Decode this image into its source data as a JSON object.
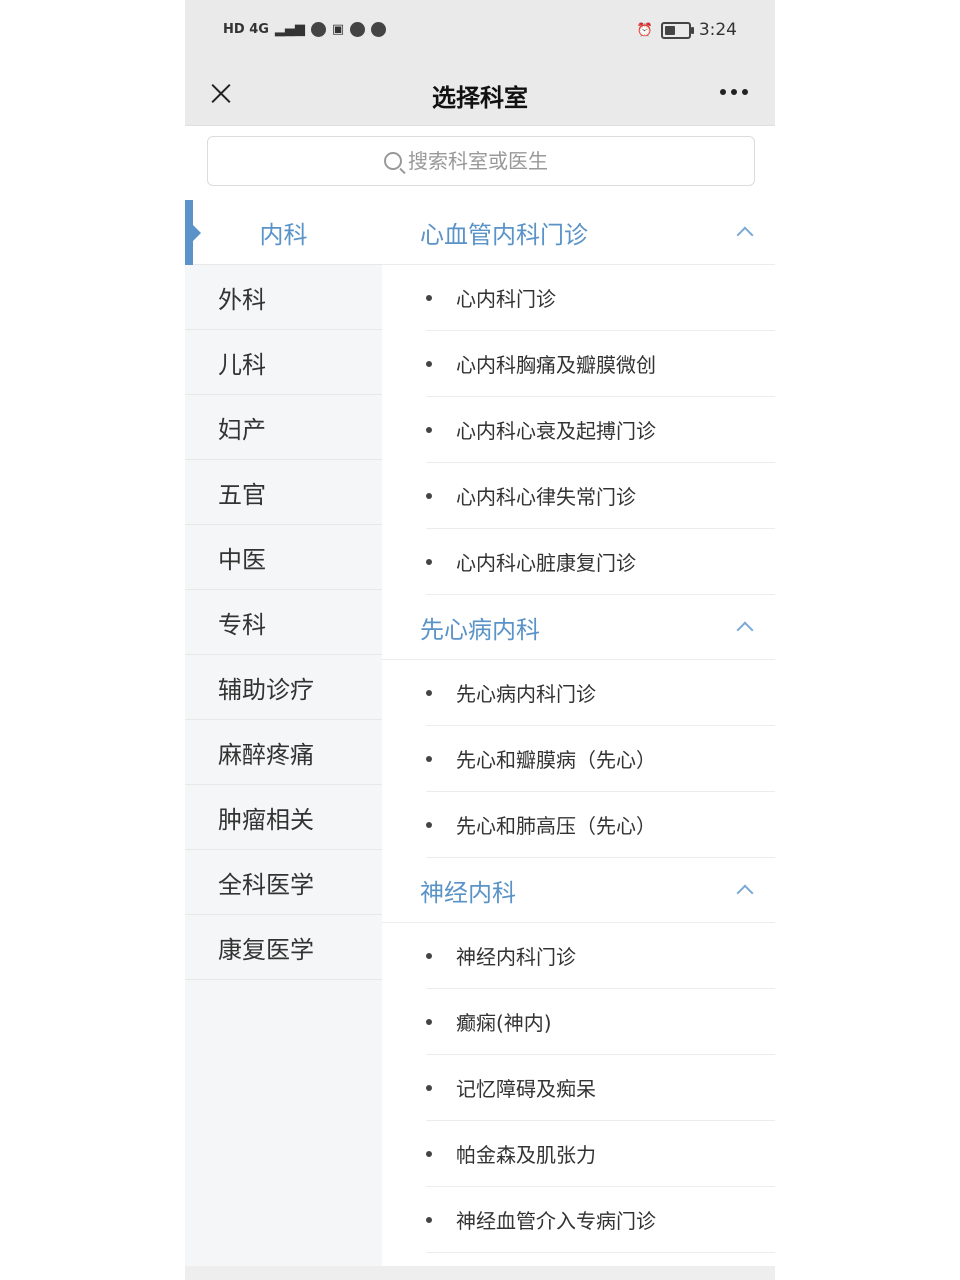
{
  "status_bar": {
    "network": "HD 4G",
    "time": "3:24"
  },
  "header": {
    "title": "选择科室"
  },
  "search": {
    "placeholder": "搜索科室或医生"
  },
  "nav": {
    "items": [
      {
        "label": "内科",
        "active": true
      },
      {
        "label": "外科"
      },
      {
        "label": "儿科"
      },
      {
        "label": "妇产"
      },
      {
        "label": "五官"
      },
      {
        "label": "中医"
      },
      {
        "label": "专科"
      },
      {
        "label": "辅助诊疗"
      },
      {
        "label": "麻醉疼痛"
      },
      {
        "label": "肿瘤相关"
      },
      {
        "label": "全科医学"
      },
      {
        "label": "康复医学"
      }
    ]
  },
  "groups": [
    {
      "title": "心血管内科门诊",
      "items": [
        "心内科门诊",
        "心内科胸痛及瓣膜微创",
        "心内科心衰及起搏门诊",
        "心内科心律失常门诊",
        "心内科心脏康复门诊"
      ]
    },
    {
      "title": "先心病内科",
      "items": [
        "先心病内科门诊",
        "先心和瓣膜病（先心）",
        "先心和肺高压（先心）"
      ]
    },
    {
      "title": "神经内科",
      "items": [
        "神经内科门诊",
        "癫痫(神内)",
        "记忆障碍及痴呆",
        "帕金森及肌张力",
        "神经血管介入专病门诊"
      ]
    }
  ],
  "colors": {
    "accent": "#5a93c8",
    "nav_bg": "#f5f6f7",
    "header_bg": "#eaeaea"
  }
}
